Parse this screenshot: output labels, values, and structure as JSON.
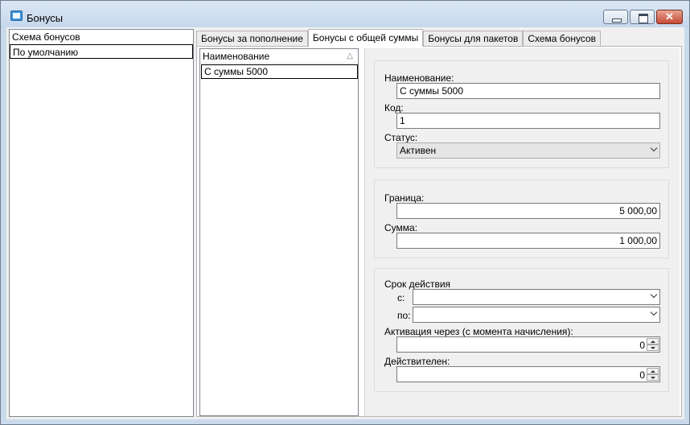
{
  "window": {
    "title": "Бонусы"
  },
  "left_list": {
    "header": "Схема бонусов",
    "items": [
      "По умолчанию"
    ]
  },
  "tabs": [
    {
      "label": "Бонусы за пополнение",
      "active": false
    },
    {
      "label": "Бонусы с общей суммы",
      "active": true
    },
    {
      "label": "Бонусы для пакетов",
      "active": false
    },
    {
      "label": "Схема бонусов",
      "active": false
    }
  ],
  "grid": {
    "column": "Наименование",
    "rows": [
      "С суммы 5000"
    ]
  },
  "detail": {
    "name_label": "Наименование:",
    "name_value": "С суммы 5000",
    "code_label": "Код:",
    "code_value": "1",
    "status_label": "Статус:",
    "status_value": "Активен",
    "limit_label": "Граница:",
    "limit_value": "5 000,00",
    "sum_label": "Сумма:",
    "sum_value": "1 000,00",
    "validity_label": "Срок действия",
    "from_label": "с:",
    "from_value": "",
    "to_label": "по:",
    "to_value": "",
    "activation_label": "Активация через (с момента начисления):",
    "activation_value": "0",
    "valid_label": "Действителен:",
    "valid_value": "0"
  }
}
